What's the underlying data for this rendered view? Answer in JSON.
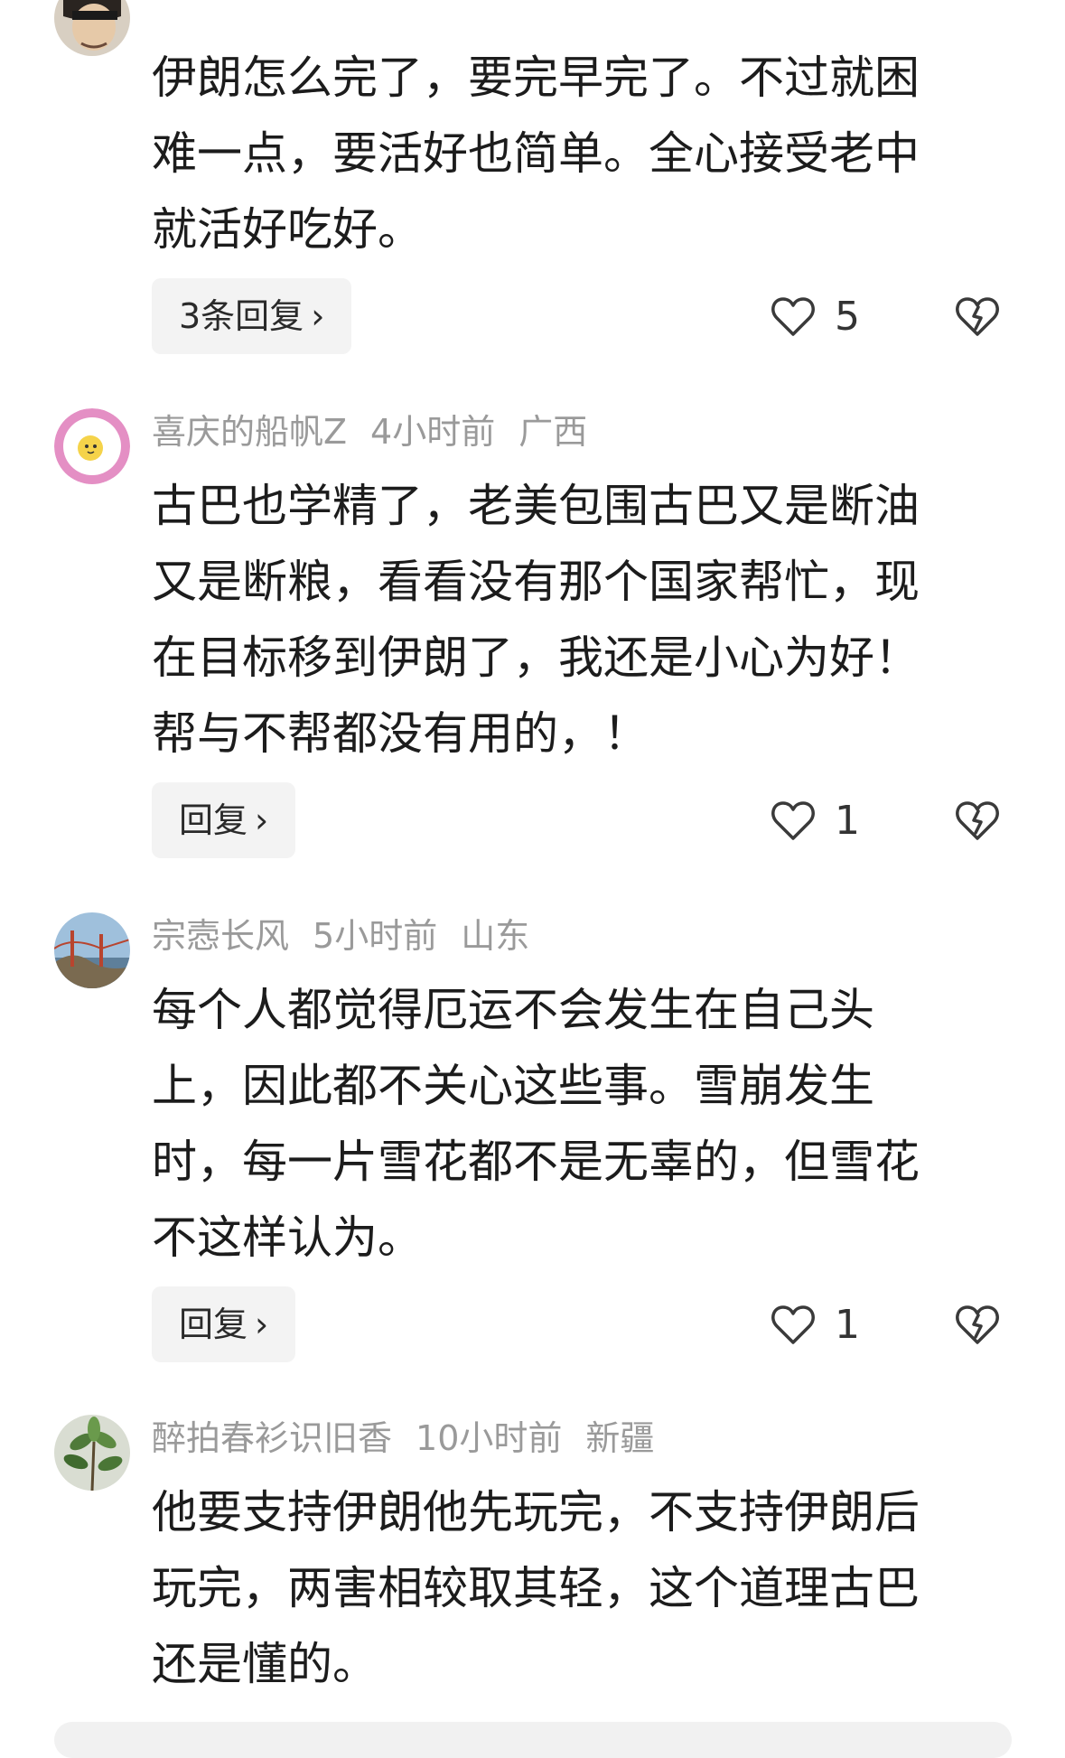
{
  "comments": [
    {
      "user": "",
      "time": "",
      "location": "",
      "text_lines": [
        "伊朗怎么完了，要完早完了。不过就困",
        "难一点，要活好也简单。全心接受老中",
        "就活好吃好。"
      ],
      "reply_label": "3条回复",
      "likes": "5"
    },
    {
      "user": "喜庆的船帆Z",
      "time": "4小时前",
      "location": "广西",
      "text_lines": [
        "古巴也学精了，老美包围古巴又是断油",
        "又是断粮，看看没有那个国家帮忙，现",
        "在目标移到伊朗了，我还是小心为好！",
        "帮与不帮都没有用的，！"
      ],
      "reply_label": "回复",
      "likes": "1"
    },
    {
      "user": "宗悫长风",
      "time": "5小时前",
      "location": "山东",
      "text_lines": [
        "每个人都觉得厄运不会发生在自己头",
        "上，因此都不关心这些事。雪崩发生",
        "时，每一片雪花都不是无辜的，但雪花",
        "不这样认为。"
      ],
      "reply_label": "回复",
      "likes": "1"
    },
    {
      "user": "醉拍春衫识旧香",
      "time": "10小时前",
      "location": "新疆",
      "text_lines": [
        "他要支持伊朗他先玩完，不支持伊朗后",
        "玩完，两害相较取其轻，这个道理古巴",
        "还是懂的。"
      ]
    }
  ],
  "icons": {
    "like": "heart-outline-icon",
    "dislike": "broken-heart-icon",
    "chevron": "chevron-right-icon"
  },
  "colors": {
    "meta_text": "#9a9a9a",
    "reply_bg": "#f3f3f3",
    "icon_stroke": "#3a3a3a"
  }
}
